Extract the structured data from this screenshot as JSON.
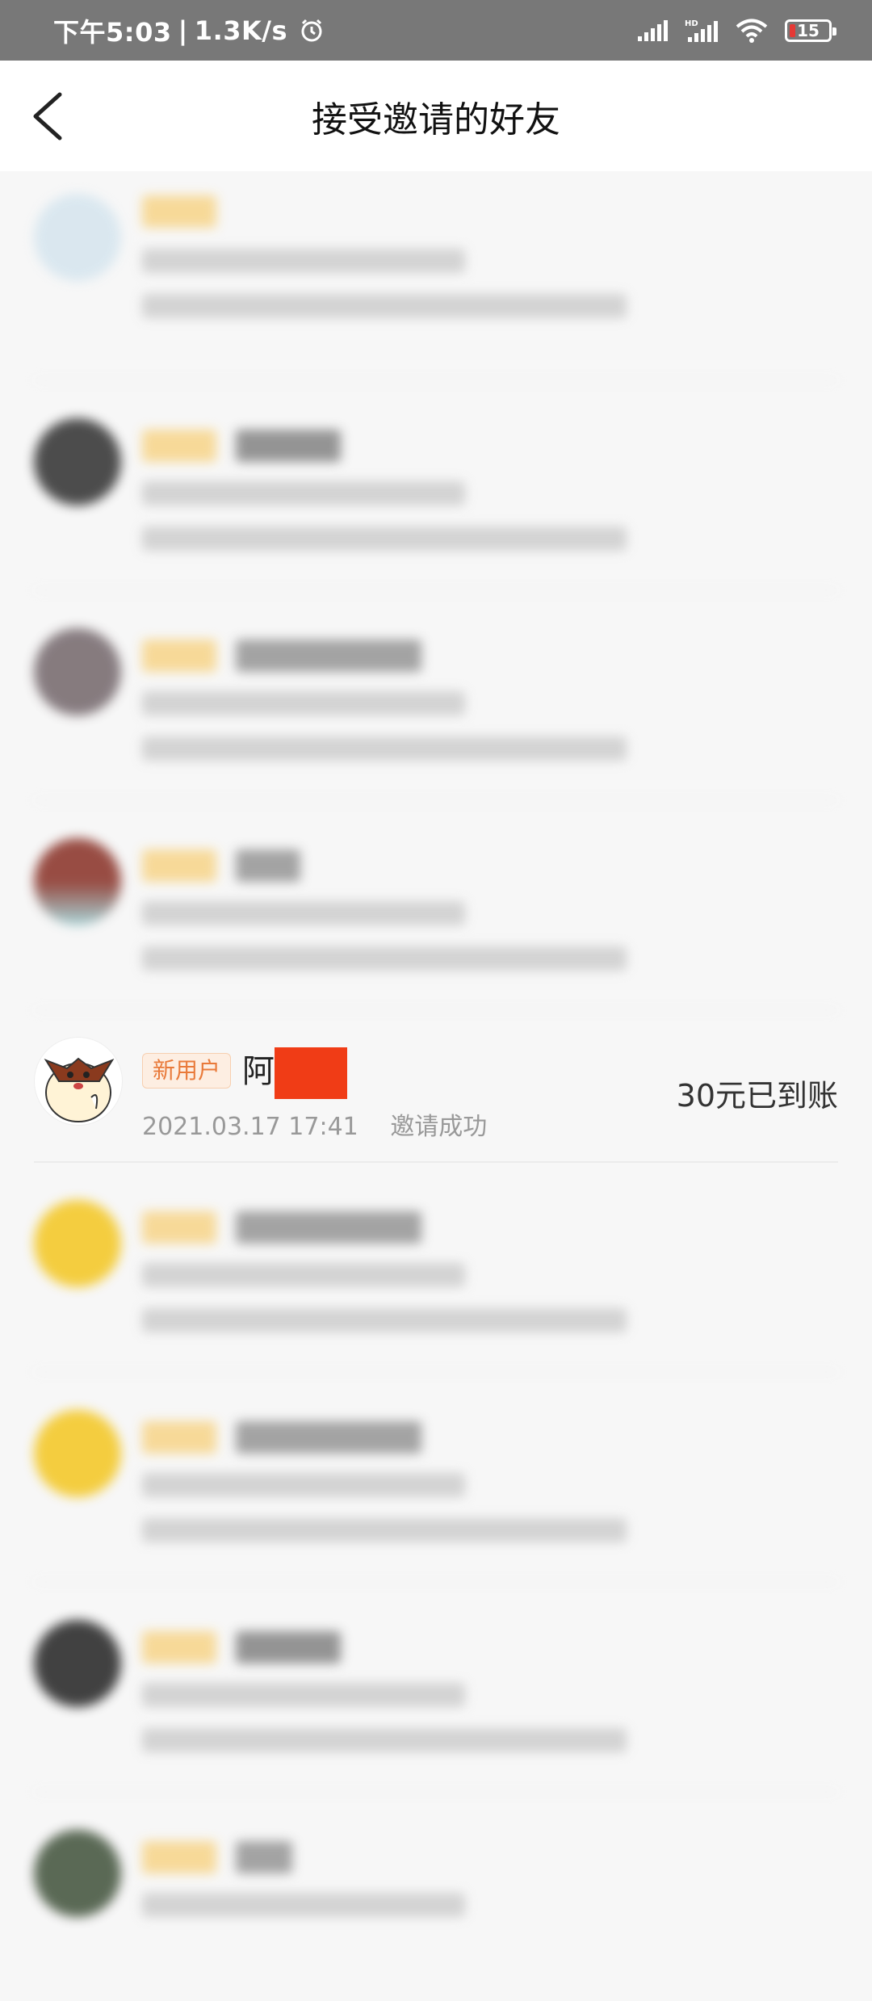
{
  "status_bar": {
    "time": "下午5:03",
    "network_speed": "1.3K/s",
    "battery_level": "15",
    "separator": "|"
  },
  "header": {
    "title": "接受邀请的好友"
  },
  "friends": [
    {
      "tag": "新用户",
      "name": "阿",
      "date": "2021.03.17 17:41",
      "status": "邀请成功",
      "reward": "30元已到账"
    }
  ],
  "colors": {
    "accent": "#e97a3a",
    "redaction": "#f03c16",
    "status_bar_bg": "#787878"
  },
  "icons": [
    "back-arrow-icon",
    "alarm-icon",
    "signal-icon",
    "wifi-icon",
    "battery-icon"
  ]
}
